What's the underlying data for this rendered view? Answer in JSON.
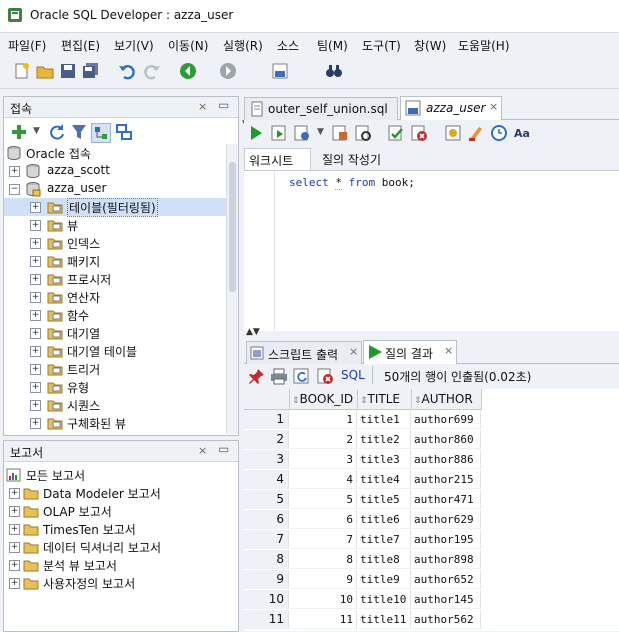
{
  "window": {
    "title": "Oracle SQL Developer : azza_user"
  },
  "menu": [
    "파일(F)",
    "편집(E)",
    "보기(V)",
    "이동(N)",
    "실행(R)",
    "소스",
    "팀(M)",
    "도구(T)",
    "창(W)",
    "도움말(H)"
  ],
  "connections": {
    "title": "접속",
    "items": [
      {
        "label": "Oracle 접속",
        "icon": "db-folder-icon"
      },
      {
        "label": "azza_scott",
        "icon": "database-icon"
      },
      {
        "label": "azza_user",
        "icon": "database-connected-icon"
      },
      {
        "label": "테이블(필터링됨)",
        "icon": "table-folder-icon"
      },
      {
        "label": "뷰",
        "icon": "view-folder-icon"
      },
      {
        "label": "인덱스",
        "icon": "index-folder-icon"
      },
      {
        "label": "패키지",
        "icon": "package-folder-icon"
      },
      {
        "label": "프로시저",
        "icon": "procedure-folder-icon"
      },
      {
        "label": "연산자",
        "icon": "operator-folder-icon"
      },
      {
        "label": "함수",
        "icon": "function-folder-icon"
      },
      {
        "label": "대기열",
        "icon": "queue-folder-icon"
      },
      {
        "label": "대기열 테이블",
        "icon": "queue-table-folder-icon"
      },
      {
        "label": "트리거",
        "icon": "trigger-folder-icon"
      },
      {
        "label": "유형",
        "icon": "type-folder-icon"
      },
      {
        "label": "시퀀스",
        "icon": "sequence-folder-icon"
      },
      {
        "label": "구체화된 뷰",
        "icon": "mview-folder-icon"
      }
    ]
  },
  "reports": {
    "title": "보고서",
    "items": [
      {
        "label": "모든 보고서"
      },
      {
        "label": "Data Modeler 보고서"
      },
      {
        "label": "OLAP 보고서"
      },
      {
        "label": "TimesTen 보고서"
      },
      {
        "label": "데이터 딕셔너리 보고서"
      },
      {
        "label": "분석 뷰 보고서"
      },
      {
        "label": "사용자정의 보고서"
      }
    ]
  },
  "editor": {
    "tabs": [
      "outer_self_union.sql",
      "azza_user"
    ],
    "subtabs": [
      "워크시트",
      "질의 작성기"
    ],
    "sql": {
      "kw1": "select",
      "star": "*",
      "kw2": "from",
      "rest": "book;"
    }
  },
  "results": {
    "tabs": [
      "스크립트 출력",
      "질의 결과"
    ],
    "sql_label": "SQL",
    "status": "50개의 행이 인출됨(0.02초)",
    "columns": [
      "BOOK_ID",
      "TITLE",
      "AUTHOR"
    ],
    "rows": [
      [
        "1",
        "1",
        "title1",
        "author699"
      ],
      [
        "2",
        "2",
        "title2",
        "author860"
      ],
      [
        "3",
        "3",
        "title3",
        "author886"
      ],
      [
        "4",
        "4",
        "title4",
        "author215"
      ],
      [
        "5",
        "5",
        "title5",
        "author471"
      ],
      [
        "6",
        "6",
        "title6",
        "author629"
      ],
      [
        "7",
        "7",
        "title7",
        "author195"
      ],
      [
        "8",
        "8",
        "title8",
        "author898"
      ],
      [
        "9",
        "9",
        "title9",
        "author652"
      ],
      [
        "10",
        "10",
        "title10",
        "author145"
      ],
      [
        "11",
        "11",
        "title11",
        "author562"
      ]
    ]
  },
  "colors": {
    "keyword": "#1e3aa8",
    "accent_green": "#1d9a2a",
    "selection": "#cfe0f7"
  }
}
